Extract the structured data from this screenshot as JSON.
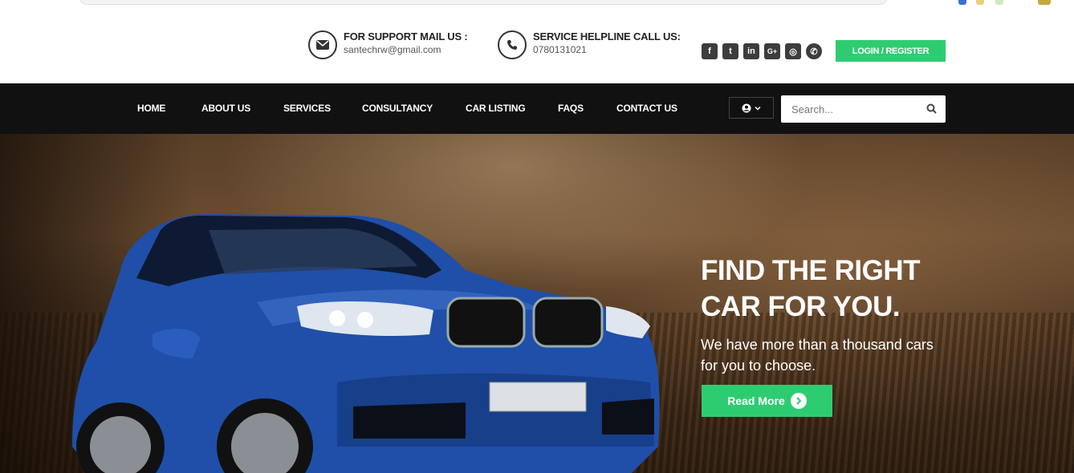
{
  "topbar": {
    "mail": {
      "label": "FOR SUPPORT MAIL US :",
      "value": "santechrw@gmail.com",
      "icon": "envelope-icon"
    },
    "phone": {
      "label": "SERVICE HELPLINE CALL US:",
      "value": "0780131021",
      "icon": "phone-icon"
    },
    "social": [
      {
        "name": "facebook-icon",
        "glyph": "f"
      },
      {
        "name": "twitter-icon",
        "glyph": "t"
      },
      {
        "name": "linkedin-icon",
        "glyph": "in"
      },
      {
        "name": "google-plus-icon",
        "glyph": "G+"
      },
      {
        "name": "instagram-icon",
        "glyph": "◎"
      },
      {
        "name": "whatsapp-icon",
        "glyph": "✆"
      }
    ],
    "login_label": "LOGIN / REGISTER"
  },
  "nav": {
    "items": [
      "HOME",
      "ABOUT US",
      "SERVICES",
      "CONSULTANCY",
      "CAR LISTING",
      "FAQS",
      "CONTACT US"
    ],
    "user_icon": "user-circle-icon",
    "search_placeholder": "Search..."
  },
  "hero": {
    "title_line1": "FIND THE RIGHT",
    "title_line2": "CAR FOR YOU.",
    "subtitle_line1": "We have more than a thousand cars",
    "subtitle_line2": "for you to choose.",
    "button_label": "Read More"
  },
  "colors": {
    "accent": "#2ecc71",
    "nav_bg": "#111111",
    "car_blue": "#1f4fa8"
  }
}
